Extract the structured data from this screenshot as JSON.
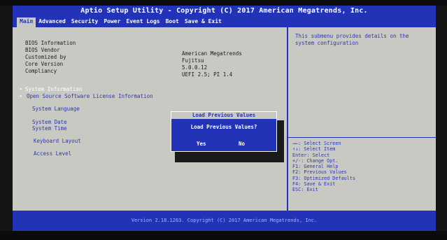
{
  "title": "Aptio Setup Utility - Copyright (C) 2017 American Megatrends, Inc.",
  "tabs": [
    "Main",
    "Advanced",
    "Security",
    "Power",
    "Event Logs",
    "Boot",
    "Save & Exit"
  ],
  "info": {
    "bios_information": "BIOS Information",
    "bios_vendor_label": "BIOS Vendor",
    "customized_by_label": "Customized by",
    "core_version_label": "Core Version",
    "compliancy_label": "Compliancy",
    "bios_vendor_value": "American Megatrends",
    "customized_by_value": "Fujitsu",
    "core_version_value": "5.0.0.12",
    "compliancy_value": "UEFI 2.5; PI 1.4"
  },
  "menu": {
    "system_information": "System Information",
    "open_source": "Open Source Software License Information",
    "system_language": "System Language",
    "system_date": "System Date",
    "system_time": "System Time",
    "keyboard_layout": "Keyboard Layout",
    "access_level": "Access Level"
  },
  "help": {
    "description": "This submenu provides details on the system configuration",
    "keys": [
      "→←: Select Screen",
      "↑↓: Select Item",
      "Enter: Select",
      "+/-: Change Opt.",
      "F1: General Help",
      "F2: Previous Values",
      "F3: Optimized Defaults",
      "F4: Save & Exit",
      "ESC: Exit"
    ]
  },
  "dialog": {
    "title": "Load Previous Values",
    "message": "Load Previous Values?",
    "yes": "Yes",
    "no": "No"
  },
  "footer": "Version 2.18.1263. Copyright (C) 2017 American Megatrends, Inc.",
  "colors": {
    "accent": "#2233b8",
    "background": "#c9c9c4",
    "text_blue": "#2a36b8"
  }
}
